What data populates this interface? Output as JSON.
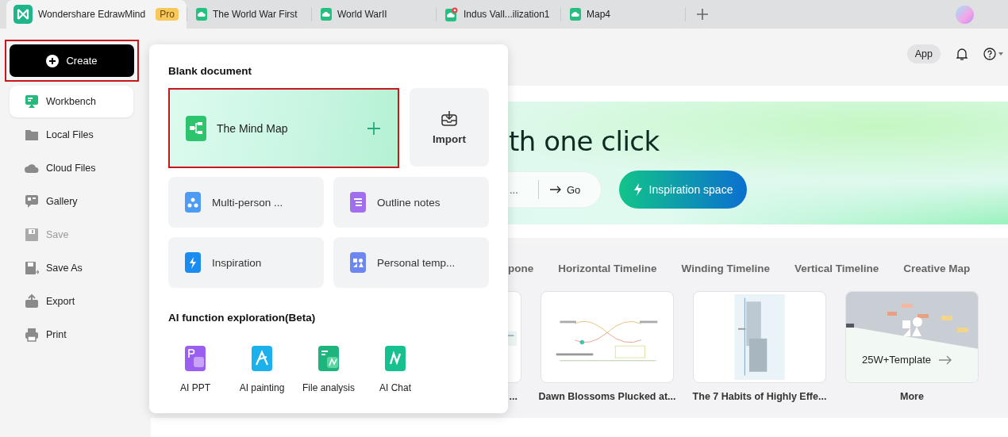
{
  "app_tabs": [
    {
      "label": "Wondershare EdrawMind",
      "kind": "home",
      "badge": "Pro",
      "selected": true
    },
    {
      "label": "The World War First",
      "kind": "doc",
      "selected": false
    },
    {
      "label": "World WarII",
      "kind": "doc",
      "selected": false
    },
    {
      "label": "Indus Vall...ilization1",
      "kind": "doc-pin",
      "selected": false
    },
    {
      "label": "Map4",
      "kind": "doc",
      "selected": false
    }
  ],
  "sidebar": {
    "create": {
      "label": "Create",
      "highlighted": true
    },
    "items": [
      {
        "label": "Workbench",
        "kind": "workbench",
        "selected": true,
        "disabled": false
      },
      {
        "label": "Local Files",
        "kind": "folder",
        "selected": false,
        "disabled": false
      },
      {
        "label": "Cloud Files",
        "kind": "cloud",
        "selected": false,
        "disabled": false
      },
      {
        "label": "Gallery",
        "kind": "gallery",
        "selected": false,
        "disabled": false
      },
      {
        "label": "Save",
        "kind": "save",
        "selected": false,
        "disabled": true
      },
      {
        "label": "Save As",
        "kind": "save-as",
        "selected": false,
        "disabled": false
      },
      {
        "label": "Export",
        "kind": "export",
        "selected": false,
        "disabled": false
      },
      {
        "label": "Print",
        "kind": "print",
        "selected": false,
        "disabled": false
      }
    ]
  },
  "topbar": {
    "app_button": "App"
  },
  "banner": {
    "heading": "th one click",
    "search": {
      "placeholder": "..."
    },
    "go_button": "Go",
    "inspiration_button": "Inspiration space"
  },
  "template_categories": [
    "pone",
    "Horizontal Timeline",
    "Winding Timeline",
    "Vertical Timeline",
    "Creative Map"
  ],
  "templates": [
    {
      "caption": "...",
      "kind": "clipped"
    },
    {
      "caption": "Dawn Blossoms Plucked at...",
      "kind": "map"
    },
    {
      "caption": "The 7 Habits of Highly Effe...",
      "kind": "tree"
    },
    {
      "caption": "More",
      "kind": "more",
      "overlay": "25W+Template"
    }
  ],
  "create_popup": {
    "blank_title": "Blank document",
    "mind_map": {
      "label": "The Mind Map",
      "highlighted": true
    },
    "import_button": "Import",
    "options": [
      {
        "label": "Multi-person ...",
        "kind": "multi"
      },
      {
        "label": "Outline notes",
        "kind": "outline"
      },
      {
        "label": "Inspiration",
        "kind": "inspiration"
      },
      {
        "label": "Personal temp...",
        "kind": "personal"
      }
    ],
    "ai_title": "AI function exploration(Beta)",
    "ai_tools": [
      {
        "label": "AI PPT",
        "kind": "ppt"
      },
      {
        "label": "AI painting",
        "kind": "painting"
      },
      {
        "label": "File analysis",
        "kind": "file"
      },
      {
        "label": "AI Chat",
        "kind": "chat"
      }
    ]
  }
}
